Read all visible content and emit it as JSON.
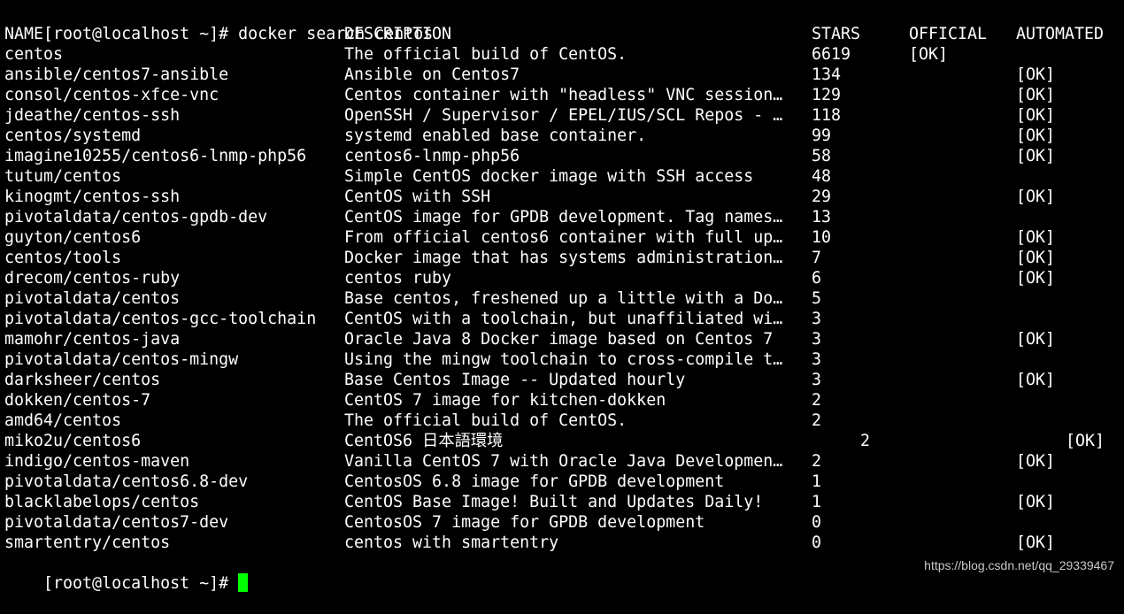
{
  "terminal": {
    "command_prompt": "[root@localhost ~]# ",
    "command": "docker search centos",
    "final_prompt": "[root@localhost ~]# ",
    "cursor_color": "#00ff00",
    "background_color": "#000000",
    "text_color": "#ffffff"
  },
  "table": {
    "headers": {
      "name": "NAME",
      "description": "DESCRIPTION",
      "stars": "STARS",
      "official": "OFFICIAL",
      "automated": "AUTOMATED"
    },
    "rows": [
      {
        "name": "centos",
        "description": "The official build of CentOS.",
        "stars": "6619",
        "official": "[OK]",
        "automated": ""
      },
      {
        "name": "ansible/centos7-ansible",
        "description": "Ansible on Centos7",
        "stars": "134",
        "official": "",
        "automated": "[OK]"
      },
      {
        "name": "consol/centos-xfce-vnc",
        "description": "Centos container with \"headless\" VNC session…",
        "stars": "129",
        "official": "",
        "automated": "[OK]"
      },
      {
        "name": "jdeathe/centos-ssh",
        "description": "OpenSSH / Supervisor / EPEL/IUS/SCL Repos - …",
        "stars": "118",
        "official": "",
        "automated": "[OK]"
      },
      {
        "name": "centos/systemd",
        "description": "systemd enabled base container.",
        "stars": "99",
        "official": "",
        "automated": "[OK]"
      },
      {
        "name": "imagine10255/centos6-lnmp-php56",
        "description": "centos6-lnmp-php56",
        "stars": "58",
        "official": "",
        "automated": "[OK]"
      },
      {
        "name": "tutum/centos",
        "description": "Simple CentOS docker image with SSH access",
        "stars": "48",
        "official": "",
        "automated": ""
      },
      {
        "name": "kinogmt/centos-ssh",
        "description": "CentOS with SSH",
        "stars": "29",
        "official": "",
        "automated": "[OK]"
      },
      {
        "name": "pivotaldata/centos-gpdb-dev",
        "description": "CentOS image for GPDB development. Tag names…",
        "stars": "13",
        "official": "",
        "automated": ""
      },
      {
        "name": "guyton/centos6",
        "description": "From official centos6 container with full up…",
        "stars": "10",
        "official": "",
        "automated": "[OK]"
      },
      {
        "name": "centos/tools",
        "description": "Docker image that has systems administration…",
        "stars": "7",
        "official": "",
        "automated": "[OK]"
      },
      {
        "name": "drecom/centos-ruby",
        "description": "centos ruby",
        "stars": "6",
        "official": "",
        "automated": "[OK]"
      },
      {
        "name": "pivotaldata/centos",
        "description": "Base centos, freshened up a little with a Do…",
        "stars": "5",
        "official": "",
        "automated": ""
      },
      {
        "name": "pivotaldata/centos-gcc-toolchain",
        "description": "CentOS with a toolchain, but unaffiliated wi…",
        "stars": "3",
        "official": "",
        "automated": ""
      },
      {
        "name": "mamohr/centos-java",
        "description": "Oracle Java 8 Docker image based on Centos 7",
        "stars": "3",
        "official": "",
        "automated": "[OK]"
      },
      {
        "name": "pivotaldata/centos-mingw",
        "description": "Using the mingw toolchain to cross-compile t…",
        "stars": "3",
        "official": "",
        "automated": ""
      },
      {
        "name": "darksheer/centos",
        "description": "Base Centos Image -- Updated hourly",
        "stars": "3",
        "official": "",
        "automated": "[OK]"
      },
      {
        "name": "dokken/centos-7",
        "description": "CentOS 7 image for kitchen-dokken",
        "stars": "2",
        "official": "",
        "automated": ""
      },
      {
        "name": "amd64/centos",
        "description": "The official build of CentOS.",
        "stars": "2",
        "official": "",
        "automated": ""
      },
      {
        "name": "miko2u/centos6",
        "description": "CentOS6 日本語環境",
        "stars": "2",
        "official": "",
        "automated": "[OK]",
        "shifted": true
      },
      {
        "name": "indigo/centos-maven",
        "description": "Vanilla CentOS 7 with Oracle Java Developmen…",
        "stars": "2",
        "official": "",
        "automated": "[OK]"
      },
      {
        "name": "pivotaldata/centos6.8-dev",
        "description": "CentosOS 6.8 image for GPDB development",
        "stars": "1",
        "official": "",
        "automated": ""
      },
      {
        "name": "blacklabelops/centos",
        "description": "CentOS Base Image! Built and Updates Daily!",
        "stars": "1",
        "official": "",
        "automated": "[OK]"
      },
      {
        "name": "pivotaldata/centos7-dev",
        "description": "CentosOS 7 image for GPDB development",
        "stars": "0",
        "official": "",
        "automated": ""
      },
      {
        "name": "smartentry/centos",
        "description": "centos with smartentry",
        "stars": "0",
        "official": "",
        "automated": "[OK]"
      }
    ]
  },
  "watermark": {
    "text": "https://blog.csdn.net/qq_29339467"
  }
}
